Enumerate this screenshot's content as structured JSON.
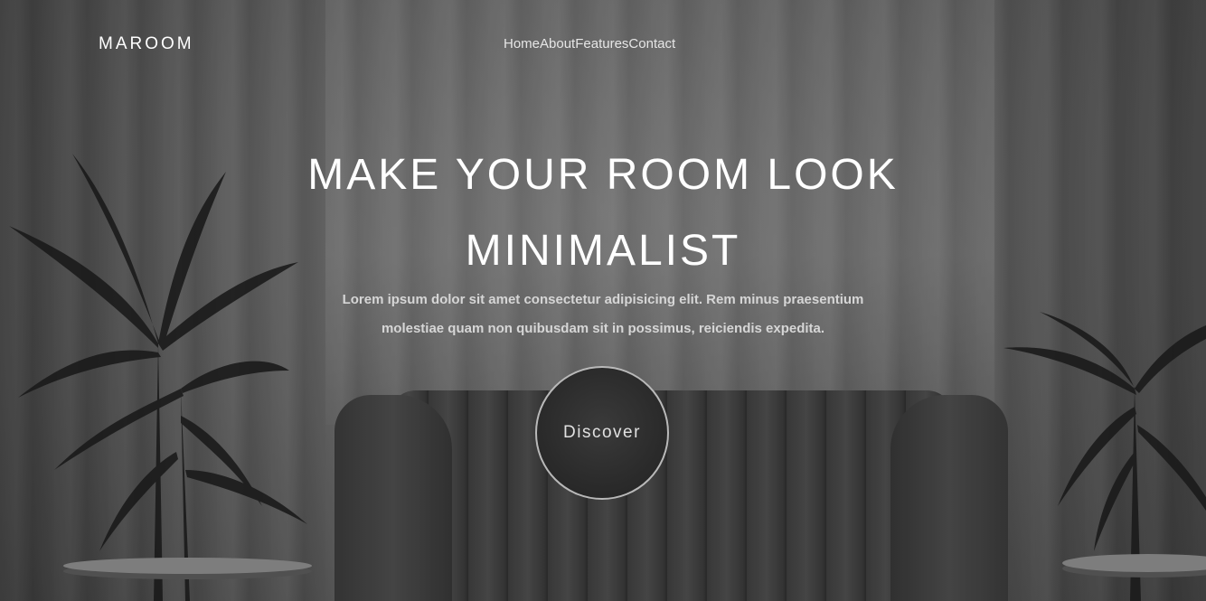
{
  "nav": {
    "logo": "MAROOM",
    "links": [
      "Home",
      "About",
      "Features",
      "Contact"
    ]
  },
  "hero": {
    "title_line1": "MAKE YOUR ROOM LOOK",
    "title_line2": "MINIMALIST",
    "description": "Lorem ipsum dolor sit amet consectetur adipisicing elit. Rem minus praesentium molestiae quam non quibusdam sit in possimus, reiciendis expedita.",
    "button_label": "Discover"
  },
  "colors": {
    "text": "#ffffff",
    "background": "#666666",
    "button_bg": "#2b2b2b"
  }
}
